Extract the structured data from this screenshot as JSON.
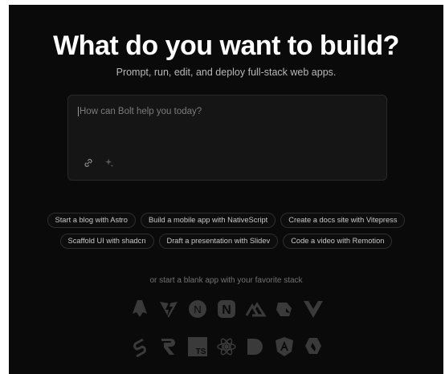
{
  "header": {
    "title": "What do you want to build?",
    "subtitle": "Prompt, run, edit, and deploy full-stack web apps."
  },
  "prompt": {
    "placeholder": "How can Bolt help you today?",
    "tools": [
      "link-icon",
      "sparkle-icon"
    ]
  },
  "suggestions": {
    "row1": [
      "Start a blog with Astro",
      "Build a mobile app with NativeScript",
      "Create a docs site with Vitepress"
    ],
    "row2": [
      "Scaffold UI with shadcn",
      "Draft a presentation with Slidev",
      "Code a video with Remotion"
    ]
  },
  "stack": {
    "label": "or start a blank app with your favorite stack",
    "icons_row1": [
      "astro-icon",
      "vite-icon",
      "nuxt-n-icon",
      "next-n-icon",
      "nuxt-mountain-icon",
      "qwik-icon",
      "vue-icon"
    ],
    "icons_row2": [
      "svelte-icon",
      "remix-icon",
      "typescript-icon",
      "react-icon",
      "slidev-icon",
      "angular-icon",
      "qwik-q-icon"
    ]
  },
  "colors": {
    "background": "#0a0a0a",
    "icon": "#3a3a3a",
    "chip_border": "#2e2e2e"
  }
}
